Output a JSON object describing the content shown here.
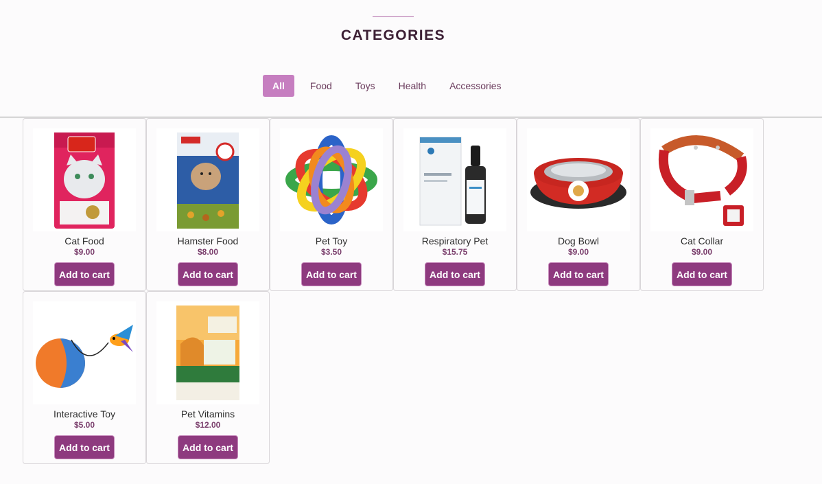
{
  "header": {
    "title": "CATEGORIES"
  },
  "tabs": [
    {
      "label": "All",
      "active": true
    },
    {
      "label": "Food",
      "active": false
    },
    {
      "label": "Toys",
      "active": false
    },
    {
      "label": "Health",
      "active": false
    },
    {
      "label": "Accessories",
      "active": false
    }
  ],
  "products": [
    {
      "name": "Cat Food",
      "price": "$9.00",
      "button": "Add to cart",
      "image_icon": "cat-food-bag-icon"
    },
    {
      "name": "Hamster Food",
      "price": "$8.00",
      "button": "Add to cart",
      "image_icon": "hamster-food-bag-icon"
    },
    {
      "name": "Pet Toy",
      "price": "$3.50",
      "button": "Add to cart",
      "image_icon": "rubber-ball-toy-icon"
    },
    {
      "name": "Respiratory Pet",
      "price": "$15.75",
      "button": "Add to cart",
      "image_icon": "medicine-bottle-icon"
    },
    {
      "name": "Dog Bowl",
      "price": "$9.00",
      "button": "Add to cart",
      "image_icon": "dog-bowl-icon"
    },
    {
      "name": "Cat Collar",
      "price": "$9.00",
      "button": "Add to cart",
      "image_icon": "collar-icon"
    },
    {
      "name": "Interactive Toy",
      "price": "$5.00",
      "button": "Add to cart",
      "image_icon": "interactive-ball-toy-icon"
    },
    {
      "name": "Pet Vitamins",
      "price": "$12.00",
      "button": "Add to cart",
      "image_icon": "flea-tick-pack-icon"
    }
  ],
  "colors": {
    "accent": "#8e3a7f",
    "tab_active": "#c67ec0",
    "title": "#3d2035"
  }
}
